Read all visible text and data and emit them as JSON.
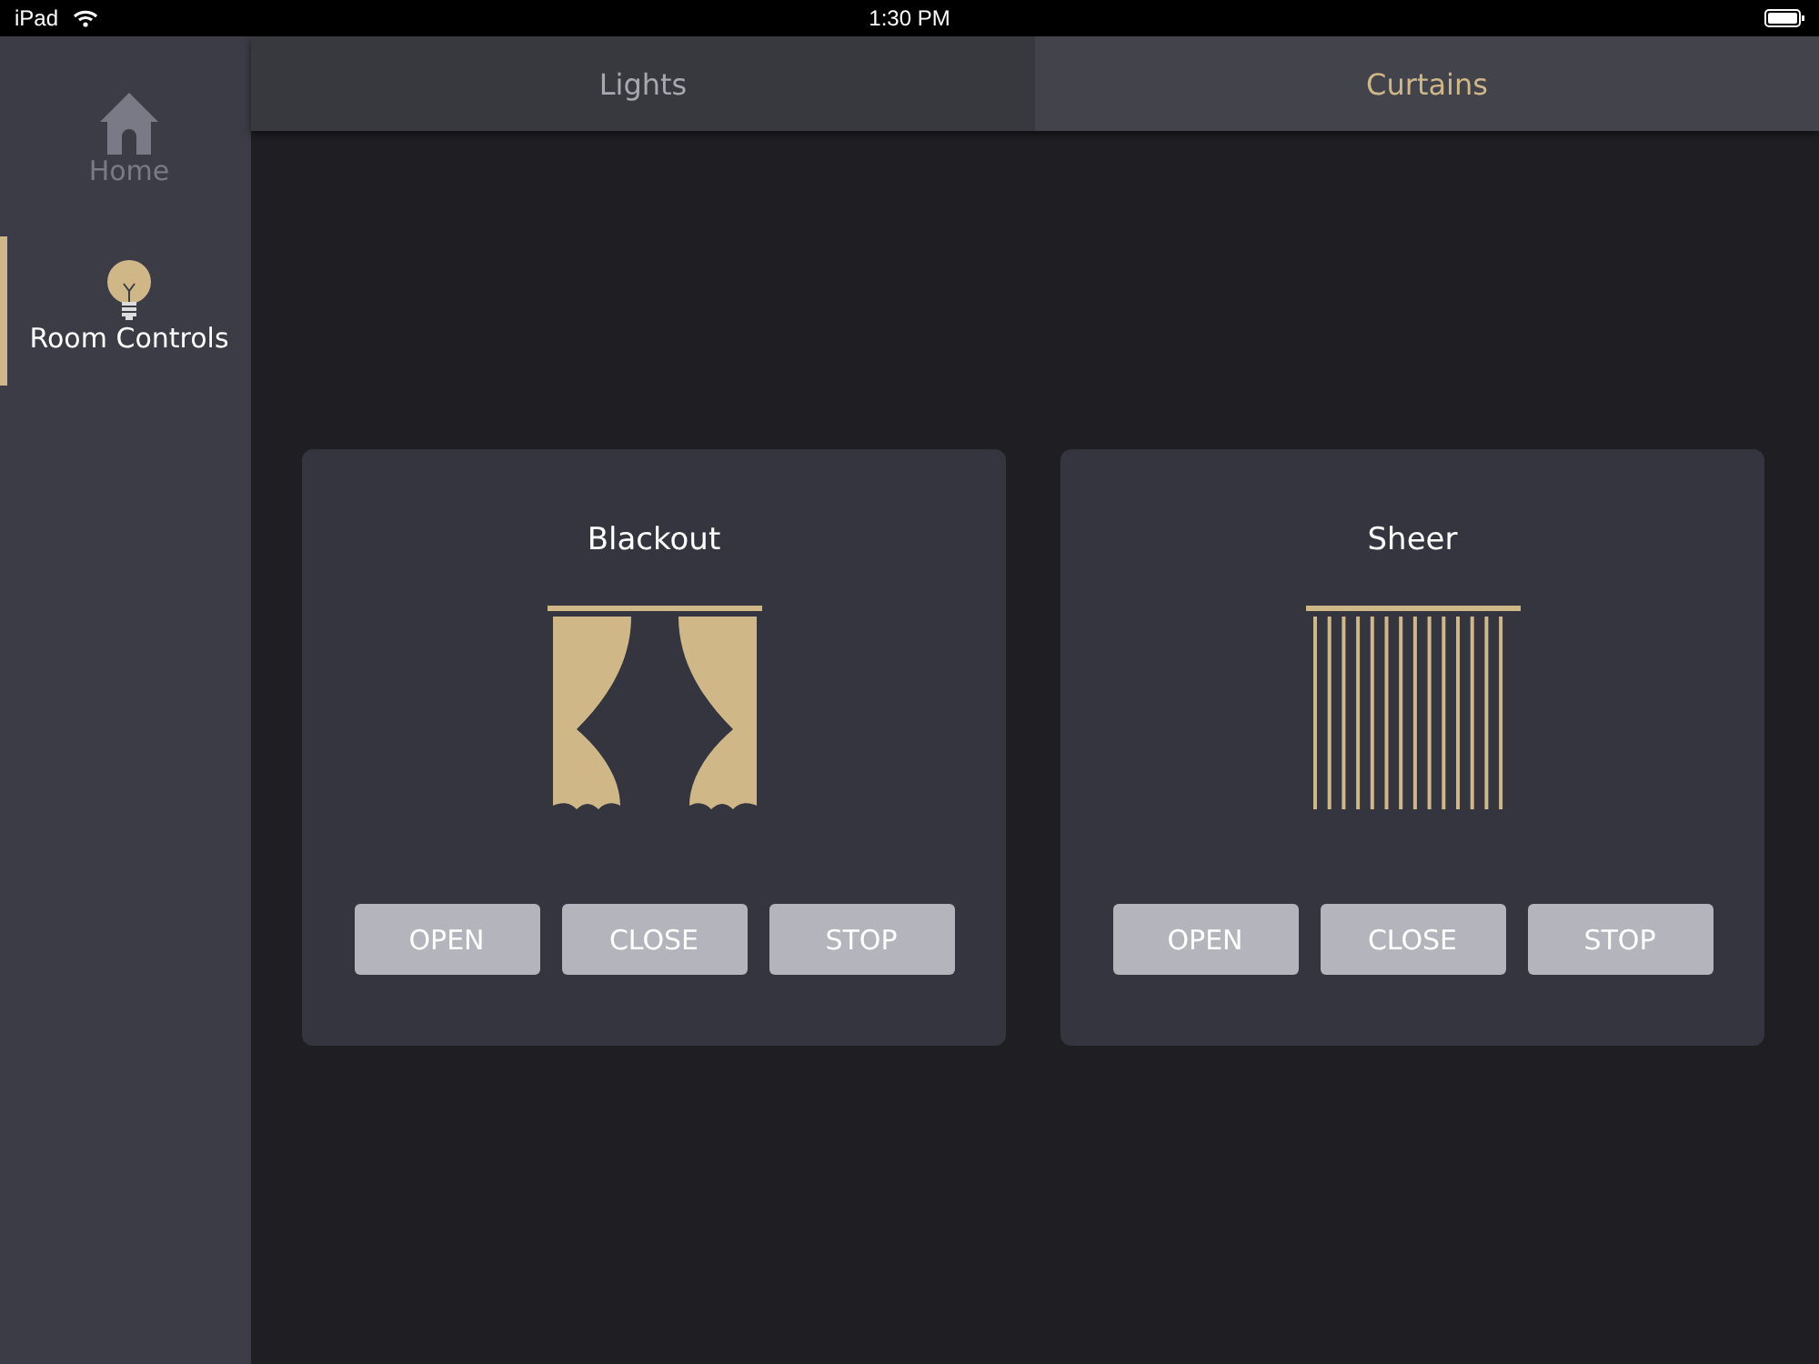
{
  "status_bar": {
    "device": "iPad",
    "time": "1:30 PM"
  },
  "sidebar": {
    "items": [
      {
        "label": "Home",
        "kind": "home",
        "selected": false
      },
      {
        "label": "Room Controls",
        "kind": "bulb",
        "selected": true
      }
    ]
  },
  "tabs": [
    {
      "label": "Lights",
      "selected": false
    },
    {
      "label": "Curtains",
      "selected": true
    }
  ],
  "cards": [
    {
      "title": "Blackout",
      "kind": "blackout",
      "buttons": [
        "OPEN",
        "CLOSE",
        "STOP"
      ]
    },
    {
      "title": "Sheer",
      "kind": "sheer",
      "buttons": [
        "OPEN",
        "CLOSE",
        "STOP"
      ]
    }
  ]
}
